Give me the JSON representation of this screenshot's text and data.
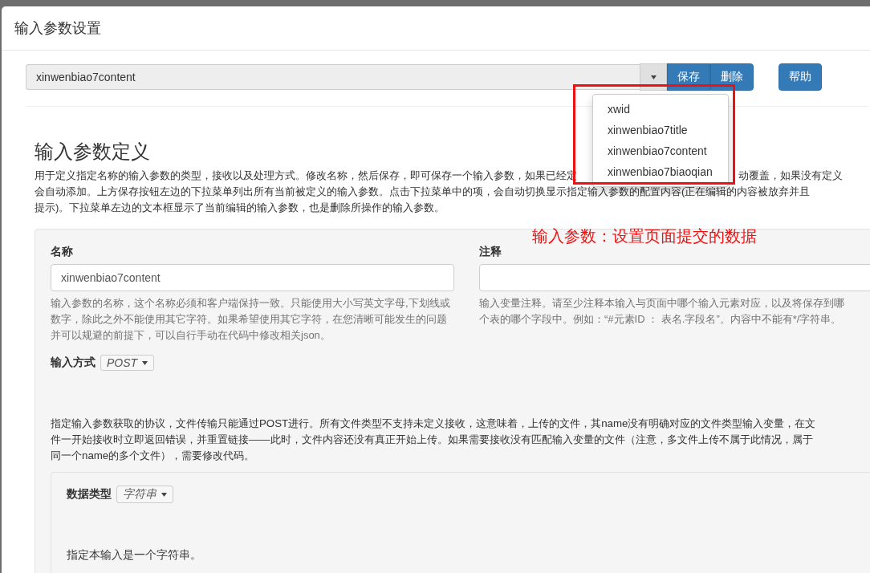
{
  "dialog": {
    "title": "输入参数设置"
  },
  "toolbar": {
    "selector": {
      "value": "xinwenbiao7content"
    },
    "buttons": [
      {
        "label": "保存"
      },
      {
        "label": "删除"
      }
    ],
    "help_button": {
      "label": "帮助"
    }
  },
  "dropdown": {
    "expanded": true,
    "items": [
      {
        "label": "xwid"
      },
      {
        "label": "xinwenbiao7title"
      },
      {
        "label": "xinwenbiao7content"
      },
      {
        "label": "xinwenbiao7biaoqian"
      }
    ]
  },
  "section": {
    "heading": "输入参数定义",
    "description_lines": [
      [
        "用于定义指定名称的输入参数的类型，接收以及处理方式。修改名称，然后保存，即可保存一个输入参数，如果已经定",
        "动覆盖，如果没有定义"
      ],
      [
        "会自动添加。上方保存按钮左边的下拉菜单列出所有当前被定义的输入参数。点击下拉菜单中的项，会自动切换显示指定输入参数的配置内容(正在编辑的内容被放弃并且"
      ],
      [
        "提示)。下拉菜单左边的文本框显示了当前编辑的输入参数，也是删除所操作的输入参数。"
      ]
    ]
  },
  "annotation": {
    "text": "输入参数：设置页面提交的数据"
  },
  "form": {
    "name": {
      "label": "名称",
      "value": "xinwenbiao7content",
      "help": "输入参数的名称，这个名称必须和客户端保持一致。只能使用大小写英文字母,下划线或数字，除此之外不能使用其它字符。如果希望使用其它字符，在您清晰可能发生的问题并可以规避的前提下，可以自行手动在代码中修改相关json。"
    },
    "comment": {
      "label": "注释",
      "help_lines": [
        "输入变量注释。请至少注释本输入与页面中哪个输入元素对应，以及将保存到哪",
        "个表的哪个字段中。例如：“#元素ID ： 表名.字段名”。内容中不能有*/字符串。"
      ]
    },
    "method": {
      "label": "输入方式",
      "value": "POST",
      "help_lines": [
        "指定输入参数获取的协议，文件传输只能通过POST进行。所有文件类型不支持未定义接收，这意味着，上传的文件，其name没有明确对应的文件类型输入变量，在文",
        "件一开始接收时立即返回错误，并重置链接——此时，文件内容还没有真正开始上传。如果需要接收没有匹配输入变量的文件（注意，多文件上传不属于此情况，属于",
        "同一个name的多个文件），需要修改代码。"
      ]
    },
    "data_type": {
      "label": "数据类型",
      "value": "字符串",
      "help": "指定本输入是一个字符串。"
    }
  }
}
